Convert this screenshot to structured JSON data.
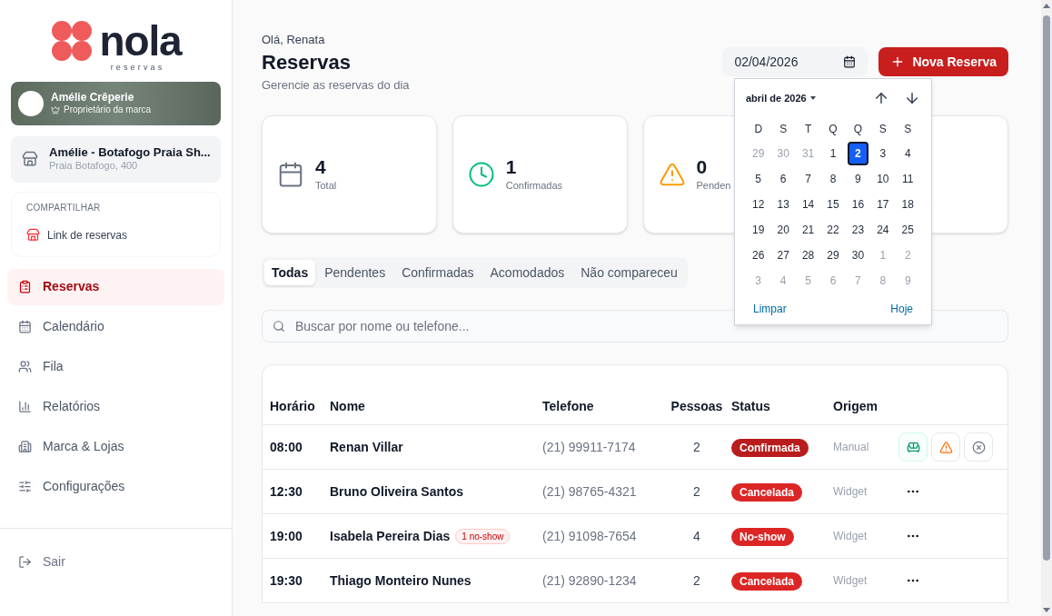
{
  "logo": {
    "name": "nola",
    "tagline": "reservas"
  },
  "brand_card": {
    "name": "Amélie Crêperie",
    "role": "Proprietário da marca"
  },
  "store_card": {
    "name": "Amélie - Botafogo Praia Sh...",
    "address": "Praia Botafogo, 400"
  },
  "share": {
    "heading": "COMPARTILHAR",
    "link": "Link de reservas"
  },
  "sidebar": {
    "items": [
      {
        "label": "Reservas",
        "selected": true
      },
      {
        "label": "Calendário",
        "selected": false
      },
      {
        "label": "Fila",
        "selected": false
      },
      {
        "label": "Relatórios",
        "selected": false
      },
      {
        "label": "Marca & Lojas",
        "selected": false
      },
      {
        "label": "Configurações",
        "selected": false
      }
    ],
    "logout": "Sair"
  },
  "header": {
    "greeting": "Olá, Renata",
    "title": "Reservas",
    "subtitle": "Gerencie as reservas do dia",
    "date_value": "02/04/2026",
    "new_button": "Nova Reserva"
  },
  "stats": [
    {
      "value": "4",
      "label": "Total"
    },
    {
      "value": "1",
      "label": "Confirmadas"
    },
    {
      "value": "0",
      "label": "Penden"
    }
  ],
  "date_picker": {
    "month": "abril de 2026",
    "weekdays": [
      "D",
      "S",
      "T",
      "Q",
      "Q",
      "S",
      "S"
    ],
    "weeks": [
      [
        {
          "day": "29",
          "outside": true,
          "selected": false
        },
        {
          "day": "30",
          "outside": true,
          "selected": false
        },
        {
          "day": "31",
          "outside": true,
          "selected": false
        },
        {
          "day": "1",
          "outside": false,
          "selected": false
        },
        {
          "day": "2",
          "outside": false,
          "selected": true
        },
        {
          "day": "3",
          "outside": false,
          "selected": false
        },
        {
          "day": "4",
          "outside": false,
          "selected": false
        }
      ],
      [
        {
          "day": "5",
          "outside": false,
          "selected": false
        },
        {
          "day": "6",
          "outside": false,
          "selected": false
        },
        {
          "day": "7",
          "outside": false,
          "selected": false
        },
        {
          "day": "8",
          "outside": false,
          "selected": false
        },
        {
          "day": "9",
          "outside": false,
          "selected": false
        },
        {
          "day": "10",
          "outside": false,
          "selected": false
        },
        {
          "day": "11",
          "outside": false,
          "selected": false
        }
      ],
      [
        {
          "day": "12",
          "outside": false,
          "selected": false
        },
        {
          "day": "13",
          "outside": false,
          "selected": false
        },
        {
          "day": "14",
          "outside": false,
          "selected": false
        },
        {
          "day": "15",
          "outside": false,
          "selected": false
        },
        {
          "day": "16",
          "outside": false,
          "selected": false
        },
        {
          "day": "17",
          "outside": false,
          "selected": false
        },
        {
          "day": "18",
          "outside": false,
          "selected": false
        }
      ],
      [
        {
          "day": "19",
          "outside": false,
          "selected": false
        },
        {
          "day": "20",
          "outside": false,
          "selected": false
        },
        {
          "day": "21",
          "outside": false,
          "selected": false
        },
        {
          "day": "22",
          "outside": false,
          "selected": false
        },
        {
          "day": "23",
          "outside": false,
          "selected": false
        },
        {
          "day": "24",
          "outside": false,
          "selected": false
        },
        {
          "day": "25",
          "outside": false,
          "selected": false
        }
      ],
      [
        {
          "day": "26",
          "outside": false,
          "selected": false
        },
        {
          "day": "27",
          "outside": false,
          "selected": false
        },
        {
          "day": "28",
          "outside": false,
          "selected": false
        },
        {
          "day": "29",
          "outside": false,
          "selected": false
        },
        {
          "day": "30",
          "outside": false,
          "selected": false
        },
        {
          "day": "1",
          "outside": true,
          "selected": false
        },
        {
          "day": "2",
          "outside": true,
          "selected": false
        }
      ],
      [
        {
          "day": "3",
          "outside": true,
          "selected": false
        },
        {
          "day": "4",
          "outside": true,
          "selected": false
        },
        {
          "day": "5",
          "outside": true,
          "selected": false
        },
        {
          "day": "6",
          "outside": true,
          "selected": false
        },
        {
          "day": "7",
          "outside": true,
          "selected": false
        },
        {
          "day": "8",
          "outside": true,
          "selected": false
        },
        {
          "day": "9",
          "outside": true,
          "selected": false
        }
      ]
    ],
    "clear": "Limpar",
    "today": "Hoje"
  },
  "tabs": [
    {
      "label": "Todas",
      "selected": true
    },
    {
      "label": "Pendentes",
      "selected": false
    },
    {
      "label": "Confirmadas",
      "selected": false
    },
    {
      "label": "Acomodados",
      "selected": false
    },
    {
      "label": "Não compareceu",
      "selected": false
    }
  ],
  "search": {
    "placeholder": "Buscar por nome ou telefone..."
  },
  "table": {
    "columns": [
      "Horário",
      "Nome",
      "Telefone",
      "Pessoas",
      "Status",
      "Origem"
    ],
    "rows": [
      {
        "time": "08:00",
        "name": "Renan Villar",
        "phone": "(21) 99911-7174",
        "people": "2",
        "status": "Confirmada",
        "color": "#b91c1c",
        "origin": "Manual",
        "kind": "buttons"
      },
      {
        "time": "12:30",
        "name": "Bruno Oliveira Santos",
        "phone": "(21) 98765-4321",
        "people": "2",
        "status": "Cancelada",
        "color": "#dc2626",
        "origin": "Widget",
        "kind": "menu"
      },
      {
        "time": "19:00",
        "name": "Isabela Pereira Dias",
        "badge": "1 no-show",
        "phone": "(21) 91098-7654",
        "people": "4",
        "status": "No-show",
        "color": "#dc2626",
        "origin": "Widget",
        "kind": "menu"
      },
      {
        "time": "19:30",
        "name": "Thiago Monteiro Nunes",
        "phone": "(21) 92890-1234",
        "people": "2",
        "status": "Cancelada",
        "color": "#dc2626",
        "origin": "Widget",
        "kind": "menu"
      }
    ]
  }
}
